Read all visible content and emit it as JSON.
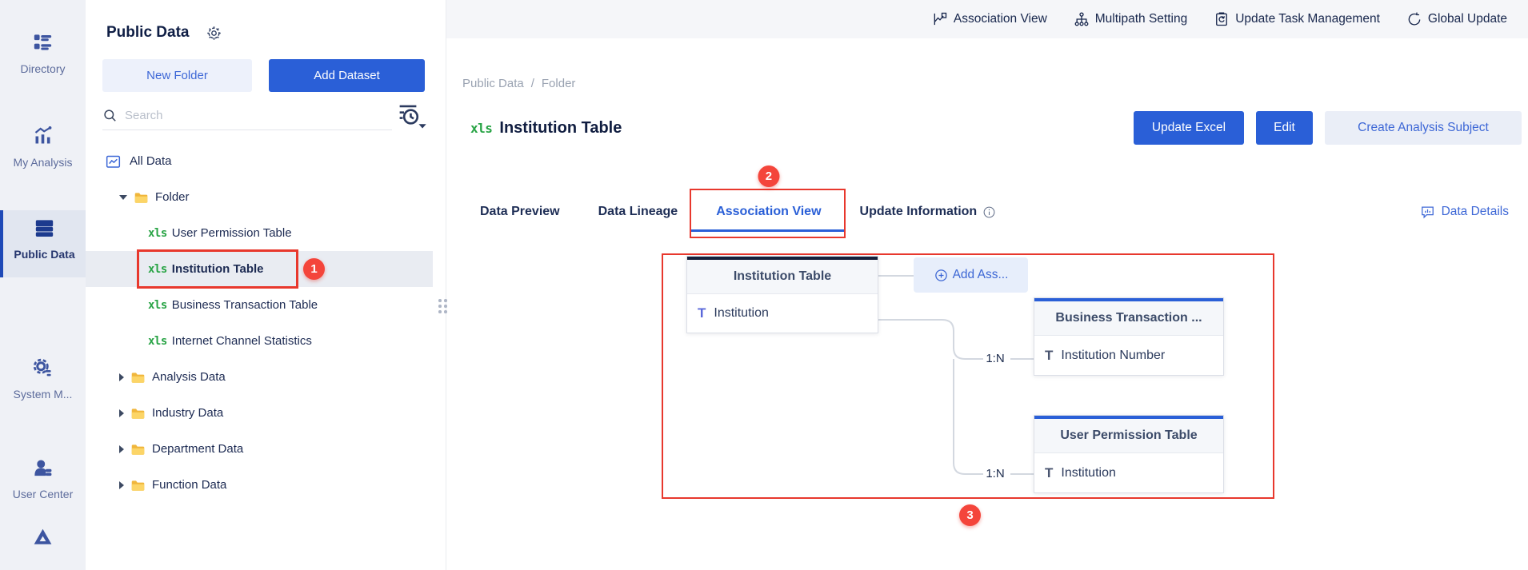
{
  "colors": {
    "primary_blue": "#2a5fd7",
    "annotation_red": "#e8382d",
    "badge_red": "#f4453b",
    "xls_green": "#27a344",
    "folder_yellow": "#f7c948"
  },
  "icons": {
    "xls_glyph": "xls",
    "field_type_glyph": "T"
  },
  "sidebar": {
    "items": [
      {
        "label": "Directory",
        "icon": "directory-icon"
      },
      {
        "label": "My Analysis",
        "icon": "analysis-icon"
      },
      {
        "label": "Public Data",
        "icon": "public-data-icon",
        "active": true
      },
      {
        "label": "System M...",
        "icon": "system-icon"
      },
      {
        "label": "User Center",
        "icon": "user-center-icon"
      },
      {
        "label": "",
        "icon": "drive-icon"
      }
    ]
  },
  "panel": {
    "title": "Public Data",
    "buttons": {
      "new_folder": "New Folder",
      "add_dataset": "Add Dataset"
    },
    "search": {
      "placeholder": "Search"
    },
    "tree": [
      {
        "label": "All Data",
        "type": "all-data"
      },
      {
        "label": "Folder",
        "type": "folder",
        "expanded": true
      },
      {
        "label": "User Permission Table",
        "type": "excel"
      },
      {
        "label": "Institution Table",
        "type": "excel",
        "selected": true,
        "badge": "1"
      },
      {
        "label": "Business Transaction Table",
        "type": "excel"
      },
      {
        "label": "Internet Channel Statistics",
        "type": "excel"
      },
      {
        "label": "Analysis Data",
        "type": "folder"
      },
      {
        "label": "Industry Data",
        "type": "folder"
      },
      {
        "label": "Department Data",
        "type": "folder"
      },
      {
        "label": "Function Data",
        "type": "folder"
      }
    ]
  },
  "toolbar": {
    "items": [
      {
        "label": "Association View",
        "icon": "association-view-icon"
      },
      {
        "label": "Multipath Setting",
        "icon": "multipath-icon"
      },
      {
        "label": "Update Task Management",
        "icon": "update-task-icon"
      },
      {
        "label": "Global Update",
        "icon": "global-update-icon"
      }
    ]
  },
  "breadcrumb": {
    "parent": "Public Data",
    "separator": "/",
    "current": "Folder"
  },
  "page": {
    "title": "Institution Table",
    "actions": {
      "update_excel": "Update Excel",
      "edit": "Edit",
      "create_analysis_subject": "Create Analysis Subject"
    },
    "tabs": [
      {
        "label": "Data Preview"
      },
      {
        "label": "Data Lineage"
      },
      {
        "label": "Association View",
        "active": true,
        "badge": "2"
      },
      {
        "label": "Update Information",
        "has_info": true
      }
    ],
    "data_details": "Data Details"
  },
  "diagram": {
    "main_table": {
      "title": "Institution Table",
      "field": "Institution"
    },
    "add_association_label": "Add Ass...",
    "related": [
      {
        "title": "Business Transaction ...",
        "field": "Institution Number",
        "relation": "1:N"
      },
      {
        "title": "User Permission Table",
        "field": "Institution",
        "relation": "1:N"
      }
    ],
    "annotation_badge": "3"
  }
}
